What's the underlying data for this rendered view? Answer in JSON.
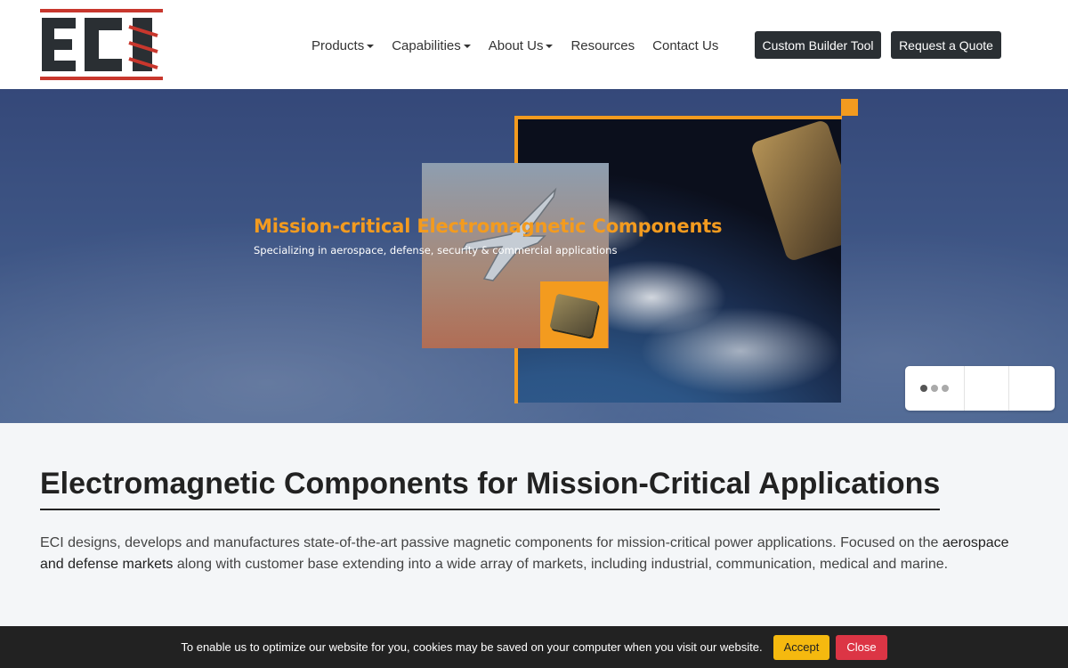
{
  "header": {
    "logo_text": "ECI",
    "nav": [
      {
        "label": "Products",
        "dropdown": true
      },
      {
        "label": "Capabilities",
        "dropdown": true
      },
      {
        "label": "About Us",
        "dropdown": true
      },
      {
        "label": "Resources",
        "dropdown": false
      },
      {
        "label": "Contact Us",
        "dropdown": false
      }
    ],
    "builder_label": "Custom Builder Tool",
    "quote_label": "Request a Quote"
  },
  "hero": {
    "title": "Mission-critical Electromagnetic Components",
    "subtitle": "Specializing in aerospace, defense, security & commercial applications",
    "slide_count": 3,
    "active_slide": 1
  },
  "content": {
    "title": "Electromagnetic Components for Mission-Critical Applications",
    "text_before": "ECI designs, develops and manufactures state-of-the-art passive magnetic components for mission-critical power applications. Focused on the ",
    "text_link": "aerospace and defense markets",
    "text_after": " along with customer base extending into a wide array of markets, including industrial, communication, medical and marine."
  },
  "cookie": {
    "message": "To enable us to optimize our website for you, cookies may be saved on your computer when you visit our website.",
    "accept_label": "Accept",
    "close_label": "Close"
  },
  "colors": {
    "accent": "#f39b1f",
    "logo_red": "#c8372d",
    "dark": "#2a2f33"
  }
}
